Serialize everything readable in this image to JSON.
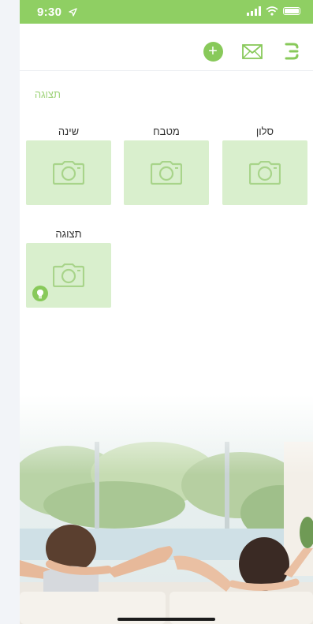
{
  "status_bar": {
    "time": "9:30",
    "color": "#8fcf63"
  },
  "toolbar": {
    "add_icon": "plus-circle-icon",
    "mail_icon": "envelope-icon",
    "menu_icon": "menu-icon"
  },
  "section": {
    "label": "תצוגה"
  },
  "rooms": [
    {
      "name": "סלון",
      "has_bulb": false
    },
    {
      "name": "מטבח",
      "has_bulb": false
    },
    {
      "name": "שינה",
      "has_bulb": false
    },
    {
      "name": "תצוגה",
      "has_bulb": true
    }
  ],
  "colors": {
    "accent": "#88c95a",
    "card": "#d9efcd",
    "section_label": "#9fd37a"
  }
}
